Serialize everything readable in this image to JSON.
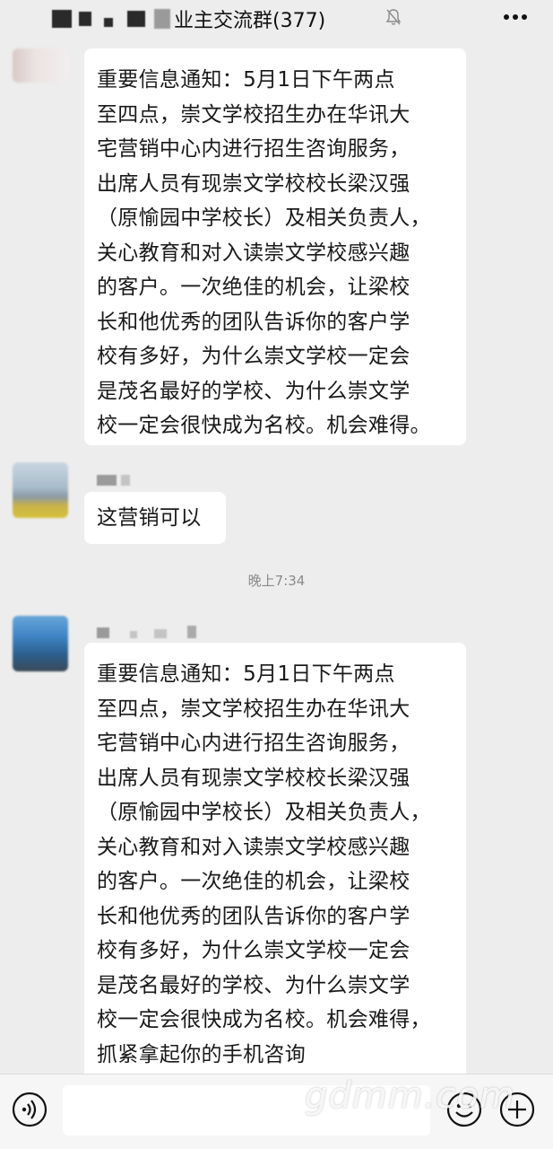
{
  "header": {
    "group_title": "业主交流群(377)",
    "mute_icon": "bell-off-icon",
    "more_icon": "ellipsis-icon"
  },
  "messages": [
    {
      "text": "重要信息通知：5月1日下午两点\n至四点，崇文学校招生办在华讯大\n宅营销中心内进行招生咨询服务，\n出席人员有现崇文学校校长梁汉强\n（原愉园中学校长）及相关负责人，\n关心教育和对入读崇文学校感兴趣\n的客户。一次绝佳的机会，让梁校\n长和他优秀的团队告诉你的客户学\n校有多好，为什么崇文学校一定会\n是茂名最好的学校、为什么崇文学\n校一定会很快成为名校。机会难得。"
    },
    {
      "text": "这营销可以"
    },
    {
      "text": "重要信息通知：5月1日下午两点\n至四点，崇文学校招生办在华讯大\n宅营销中心内进行招生咨询服务，\n出席人员有现崇文学校校长梁汉强\n（原愉园中学校长）及相关负责人，\n关心教育和对入读崇文学校感兴趣\n的客户。一次绝佳的机会，让梁校\n长和他优秀的团队告诉你的客户学\n校有多好，为什么崇文学校一定会\n是茂名最好的学校、为什么崇文学\n校一定会很快成为名校。机会难得，\n抓紧拿起你的手机咨询"
    }
  ],
  "time_divider": "晚上7:34",
  "input_bar": {
    "voice_icon": "voice-icon",
    "emoji_icon": "emoji-icon",
    "plus_icon": "plus-icon"
  },
  "watermark": "gdmm.com"
}
